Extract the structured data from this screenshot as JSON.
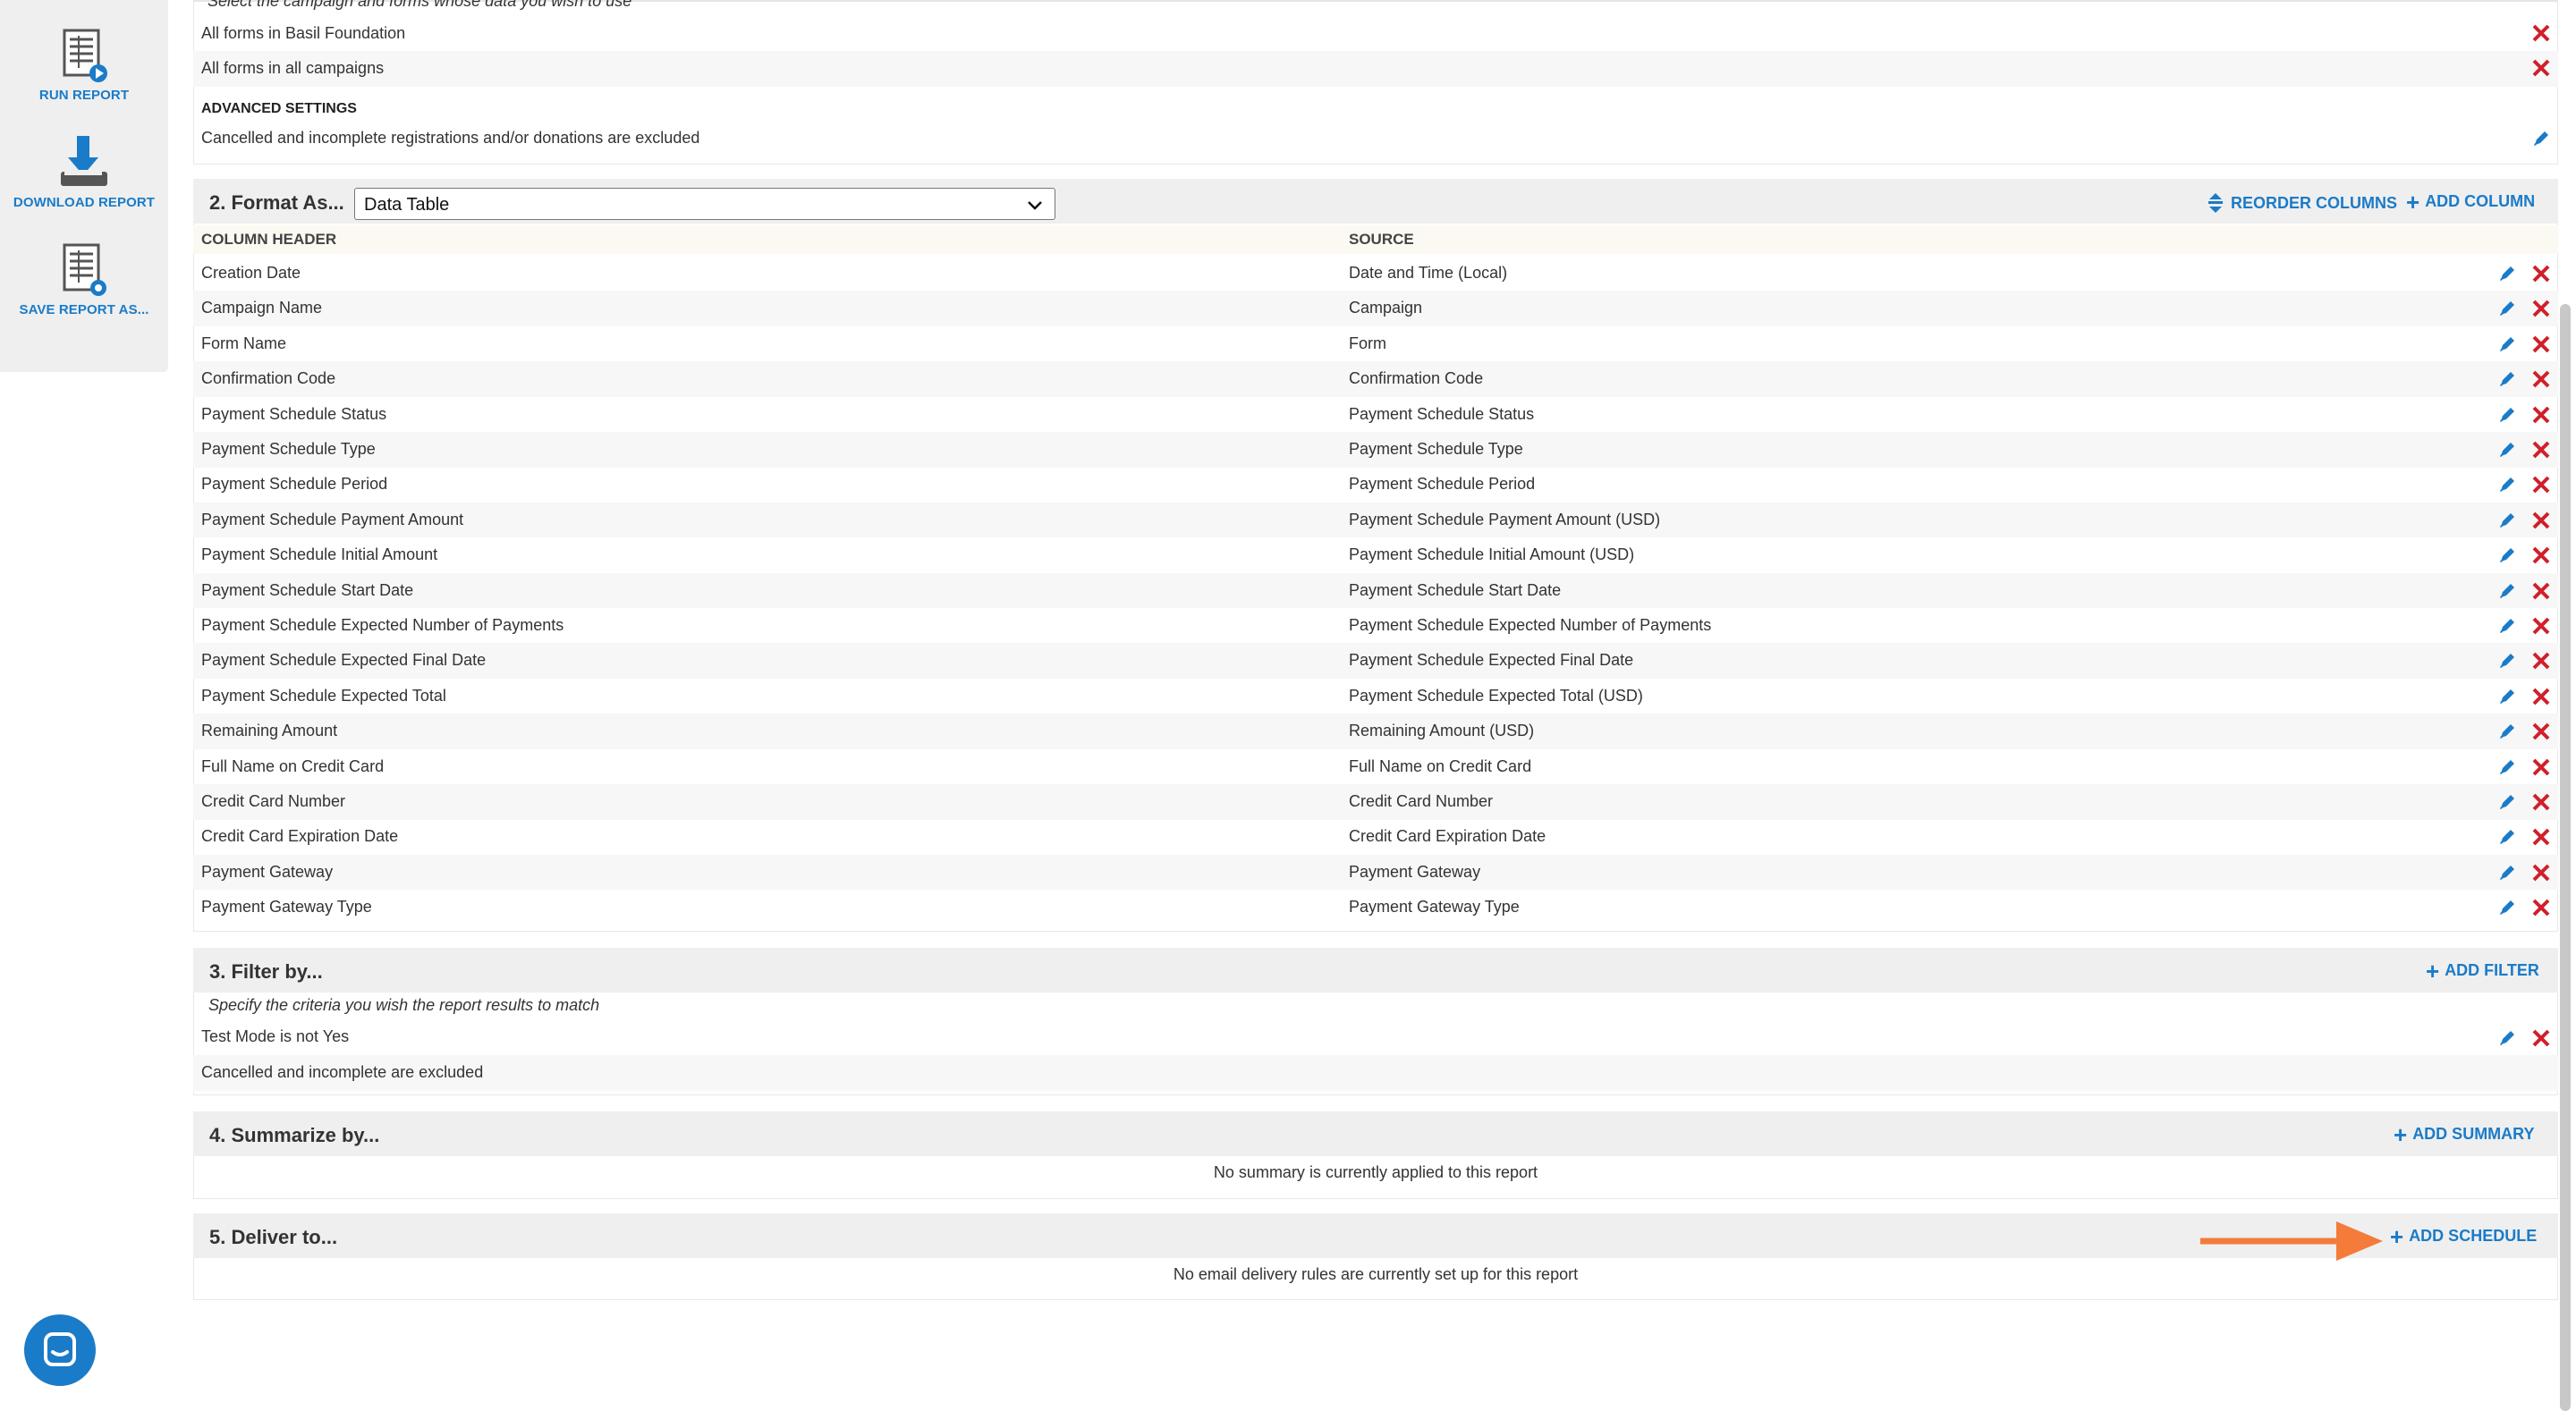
{
  "sidebar": {
    "items": [
      {
        "label": "RUN REPORT",
        "icon": "run-report-icon"
      },
      {
        "label": "DOWNLOAD REPORT",
        "icon": "download-report-icon"
      },
      {
        "label": "SAVE REPORT AS...",
        "icon": "save-report-icon"
      }
    ]
  },
  "section1": {
    "note_cut": "Select the campaign and forms whose data you wish to use",
    "sources": [
      "All forms in Basil Foundation",
      "All forms in all campaigns"
    ],
    "advanced_title": "ADVANCED SETTINGS",
    "advanced_text": "Cancelled and incomplete registrations and/or donations are excluded"
  },
  "section2": {
    "title": "2. Format As...",
    "format_value": "Data Table",
    "reorder_label": "REORDER COLUMNS",
    "add_column_label": "ADD COLUMN",
    "col_header_label": "COLUMN HEADER",
    "source_label": "SOURCE",
    "rows": [
      {
        "header": "Creation Date",
        "source": "Date and Time (Local)"
      },
      {
        "header": "Campaign Name",
        "source": "Campaign"
      },
      {
        "header": "Form Name",
        "source": "Form"
      },
      {
        "header": "Confirmation Code",
        "source": "Confirmation Code"
      },
      {
        "header": "Payment Schedule Status",
        "source": "Payment Schedule Status"
      },
      {
        "header": "Payment Schedule Type",
        "source": "Payment Schedule Type"
      },
      {
        "header": "Payment Schedule Period",
        "source": "Payment Schedule Period"
      },
      {
        "header": "Payment Schedule Payment Amount",
        "source": "Payment Schedule Payment Amount (USD)"
      },
      {
        "header": "Payment Schedule Initial Amount",
        "source": "Payment Schedule Initial Amount (USD)"
      },
      {
        "header": "Payment Schedule Start Date",
        "source": "Payment Schedule Start Date"
      },
      {
        "header": "Payment Schedule Expected Number of Payments",
        "source": "Payment Schedule Expected Number of Payments"
      },
      {
        "header": "Payment Schedule Expected Final Date",
        "source": "Payment Schedule Expected Final Date"
      },
      {
        "header": "Payment Schedule Expected Total",
        "source": "Payment Schedule Expected Total (USD)"
      },
      {
        "header": "Remaining Amount",
        "source": "Remaining Amount (USD)"
      },
      {
        "header": "Full Name on Credit Card",
        "source": "Full Name on Credit Card"
      },
      {
        "header": "Credit Card Number",
        "source": "Credit Card Number"
      },
      {
        "header": "Credit Card Expiration Date",
        "source": "Credit Card Expiration Date"
      },
      {
        "header": "Payment Gateway",
        "source": "Payment Gateway"
      },
      {
        "header": "Payment Gateway Type",
        "source": "Payment Gateway Type"
      }
    ]
  },
  "section3": {
    "title": "3. Filter by...",
    "add_filter_label": "ADD FILTER",
    "note": "Specify the criteria you wish the report results to match",
    "filter": "Test Mode is not Yes",
    "excluded": "Cancelled and incomplete are excluded"
  },
  "section4": {
    "title": "4. Summarize by...",
    "add_summary_label": "ADD SUMMARY",
    "empty": "No summary is currently applied to this report"
  },
  "section5": {
    "title": "5. Deliver to...",
    "add_schedule_label": "ADD SCHEDULE",
    "empty": "No email delivery rules are currently set up for this report"
  },
  "colors": {
    "accent": "#1a7bc8",
    "delete": "#d0202a",
    "annotation_arrow": "#f47b3a"
  }
}
